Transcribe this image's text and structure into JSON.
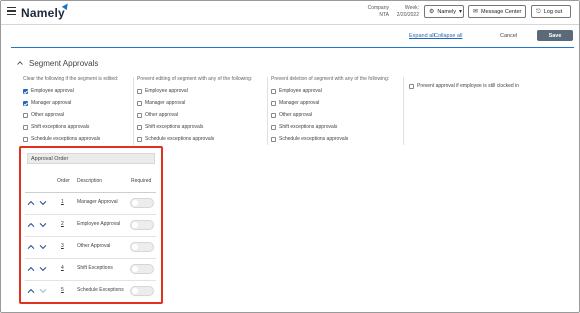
{
  "header": {
    "brand": "Namely",
    "company_label": "Company",
    "company_value": "NTA",
    "week_label": "Week:",
    "week_value": "2/20/2022",
    "namely_menu_label": "Namely",
    "message_center_label": "Message Center",
    "logout_label": "Log out"
  },
  "toolbar": {
    "expand_all": "Expand all",
    "collapse_all": "Collapse all",
    "cancel": "Cancel",
    "save": "Save"
  },
  "section": {
    "title": "Segment Approvals",
    "columns": [
      {
        "title": "Clear the following if the segment is edited:",
        "options": [
          {
            "label": "Employee approval",
            "checked": true
          },
          {
            "label": "Manager approval",
            "checked": true
          },
          {
            "label": "Other approval",
            "checked": false
          },
          {
            "label": "Shift exceptions approvals",
            "checked": false
          },
          {
            "label": "Schedule exceptions approvals",
            "checked": false
          }
        ]
      },
      {
        "title": "Prevent editing of segment with any of the following:",
        "options": [
          {
            "label": "Employee approval",
            "checked": false
          },
          {
            "label": "Manager approval",
            "checked": false
          },
          {
            "label": "Other approval",
            "checked": false
          },
          {
            "label": "Shift exceptions approvals",
            "checked": false
          },
          {
            "label": "Schedule exceptions approvals",
            "checked": false
          }
        ]
      },
      {
        "title": "Prevent deletion of segment with any of the following:",
        "options": [
          {
            "label": "Employee approval",
            "checked": false
          },
          {
            "label": "Manager approval",
            "checked": false
          },
          {
            "label": "Other approval",
            "checked": false
          },
          {
            "label": "Shift exceptions approvals",
            "checked": false
          },
          {
            "label": "Schedule exceptions approvals",
            "checked": false
          }
        ]
      }
    ],
    "prevent_clocked_in": {
      "label": "Prevent approval if employee is still clocked in",
      "checked": false
    }
  },
  "approval_order": {
    "title": "Approval Order",
    "headers": {
      "order": "Order",
      "description": "Description",
      "required": "Required"
    },
    "rows": [
      {
        "order": "1",
        "description": "Manager Approval",
        "required": false
      },
      {
        "order": "2",
        "description": "Employee Approval",
        "required": false
      },
      {
        "order": "3",
        "description": "Other Approval",
        "required": false
      },
      {
        "order": "4",
        "description": "Shift Exceptions",
        "required": false
      },
      {
        "order": "5",
        "description": "Schedule Exceptions",
        "required": false
      }
    ]
  },
  "colors": {
    "accent": "#2a66b8",
    "highlight_border": "#e0321f",
    "save_button": "#5b6a78",
    "arrow": "#1f4e8c"
  }
}
